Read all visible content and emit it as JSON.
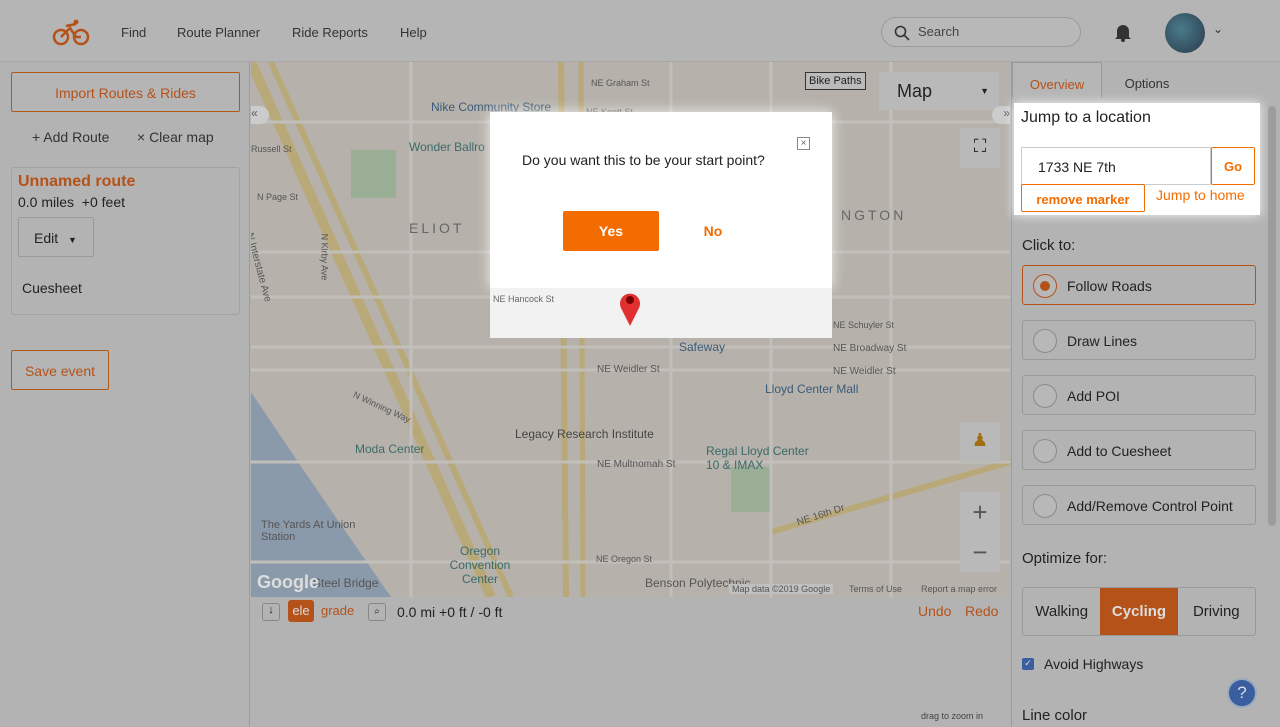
{
  "header": {
    "nav": [
      "Find",
      "Route Planner",
      "Ride Reports",
      "Help"
    ],
    "search_placeholder": "Search"
  },
  "left": {
    "import_label": "Import Routes & Rides",
    "add_route": "+ Add Route",
    "clear_map": "× Clear map",
    "route_name": "Unnamed route",
    "route_stats": "0.0 miles  +0 feet",
    "edit_label": "Edit",
    "cuesheet": "Cuesheet",
    "save_event": "Save event"
  },
  "map": {
    "bike_paths": "Bike Paths",
    "map_type": "Map",
    "labels": [
      "NE Graham St",
      "Nike Community Store",
      "NE Knott St",
      "Wonder Ballro",
      "Russell St",
      "N Page St",
      "ELIOT",
      "NGTON",
      "N Interstate Ave",
      "N Kirby Ave",
      "NE Hancock St",
      "NE Schuyler St",
      "Safeway",
      "NE Broadway St",
      "NE Weidler St",
      "Lloyd Center Mall",
      "Moda Center",
      "Legacy Research Institute",
      "Regal Lloyd Center 10 & IMAX",
      "NE Multnomah St",
      "The Yards At Union Station",
      "Oregon Convention Center",
      "Steel Bridge",
      "Benson Polytechnic",
      "NE 16th Dr",
      "NE Oregon St",
      "N Winning Way"
    ],
    "attribution": "Map data ©2019 Google",
    "terms": "Terms of Use",
    "report": "Report a map error",
    "google": "Google"
  },
  "dialog": {
    "question": "Do you want this to be your start point?",
    "yes": "Yes",
    "no": "No"
  },
  "elevation": {
    "ele": "ele",
    "grade": "grade",
    "stats": "0.0 mi +0 ft / -0 ft",
    "undo": "Undo",
    "redo": "Redo",
    "hint": "drag to zoom in"
  },
  "right": {
    "tabs": [
      "Overview",
      "Options"
    ],
    "jump_title": "Jump to a location",
    "location_value": "1733 NE 7th",
    "go": "Go",
    "remove_marker": "remove marker",
    "jump_home": "Jump to home",
    "click_to": "Click to:",
    "modes": [
      "Follow Roads",
      "Draw Lines",
      "Add POI",
      "Add to Cuesheet",
      "Add/Remove Control Point"
    ],
    "selected_mode": "Follow Roads",
    "optimize_for": "Optimize for:",
    "optimize": [
      "Walking",
      "Cycling",
      "Driving"
    ],
    "selected_optimize": "Cycling",
    "avoid_highways": "Avoid Highways",
    "avoid_checked": true,
    "line_color": "Line color"
  },
  "colors": {
    "accent": "#f36c00",
    "accent_dim": "#b4521a"
  }
}
